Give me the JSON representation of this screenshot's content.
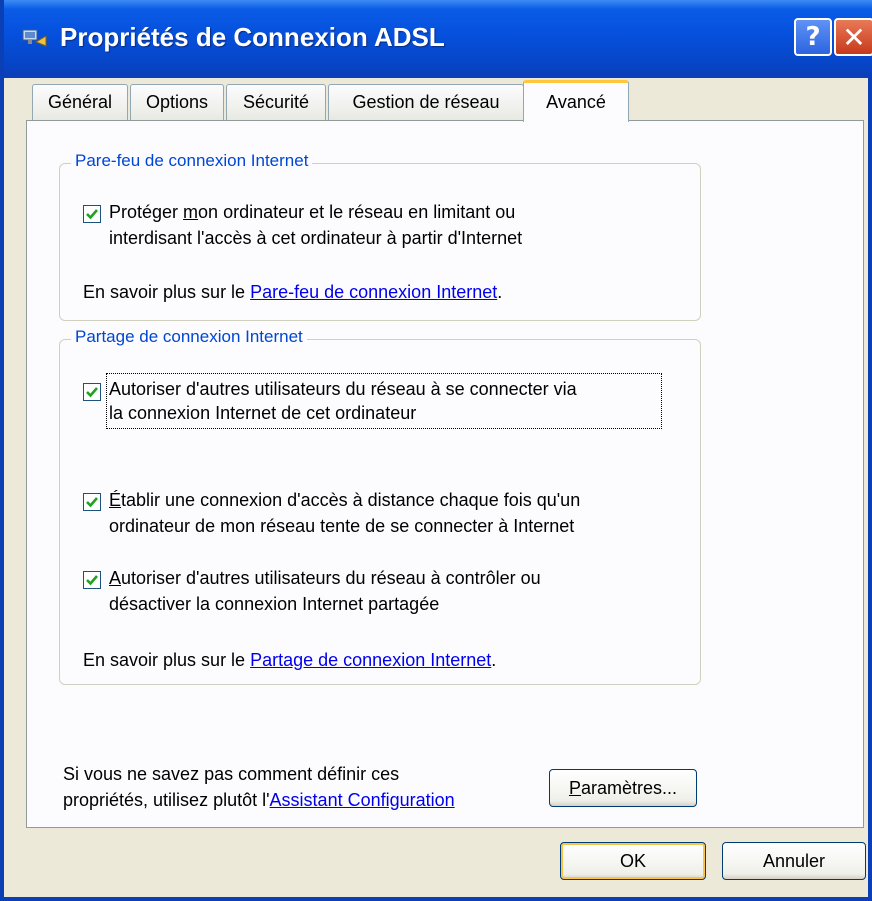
{
  "window": {
    "title": "Propriétés de Connexion ADSL",
    "help_glyph": "?",
    "close_glyph": "✕"
  },
  "tabs": [
    {
      "label": "Général"
    },
    {
      "label": "Options"
    },
    {
      "label": "Sécurité"
    },
    {
      "label": "Gestion de réseau"
    },
    {
      "label": "Avancé"
    }
  ],
  "active_tab": "Avancé",
  "firewall": {
    "title": "Pare-feu de connexion Internet",
    "protect": {
      "checked": true,
      "line1_before": "Protéger ",
      "line1_accel": "m",
      "line1_after": "on ordinateur et le réseau en limitant ou",
      "line2": "interdisant l'accès à cet ordinateur à partir d'Internet"
    },
    "learn_prefix": "En savoir plus sur le ",
    "learn_link": "Pare-feu de connexion Internet",
    "learn_suffix": "."
  },
  "sharing": {
    "title": "Partage de connexion Internet",
    "allow_others": {
      "checked": true,
      "line1": "Autoriser d'autres utilisateurs du réseau à se connecter via",
      "line2": "la connexion Internet de cet ordinateur"
    },
    "dial_on_demand": {
      "checked": true,
      "line1_accel": "É",
      "line1_after": "tablir une connexion d'accès à distance chaque fois qu'un",
      "line2": "ordinateur de mon réseau tente de se connecter à Internet"
    },
    "allow_control": {
      "checked": true,
      "line1_accel": "A",
      "line1_after": "utoriser d'autres utilisateurs du réseau à contrôler ou",
      "line2": "désactiver la connexion Internet partagée"
    },
    "learn_prefix": "En savoir plus sur le ",
    "learn_link": "Partage de connexion Internet",
    "learn_suffix": "."
  },
  "footer_hint": {
    "line1": "Si vous ne savez pas comment définir ces",
    "line2_prefix": "propriétés, utilisez plutôt l'",
    "line2_link": "Assistant Configuration"
  },
  "buttons": {
    "settings_accel": "P",
    "settings_rest": "aramètres...",
    "ok": "OK",
    "cancel": "Annuler"
  }
}
